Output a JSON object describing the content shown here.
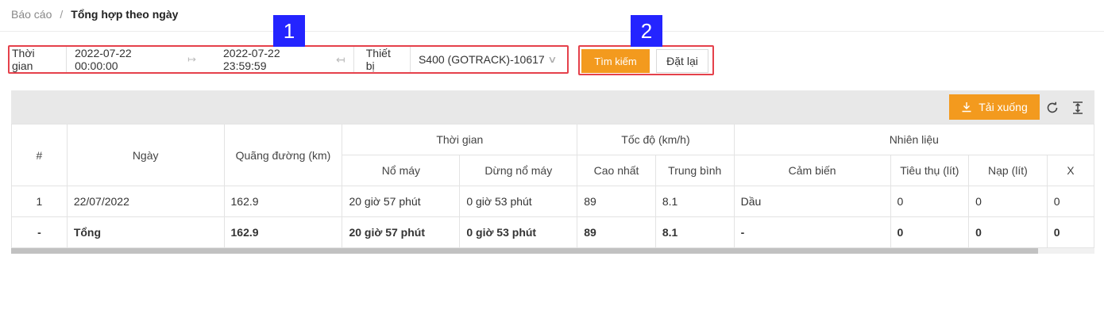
{
  "breadcrumb": {
    "root": "Báo cáo",
    "separator": "/",
    "current": "Tổng hợp theo ngày"
  },
  "filter": {
    "time_label": "Thời gian",
    "start": "2022-07-22 00:00:00",
    "end": "2022-07-22 23:59:59",
    "device_label": "Thiết bị",
    "device_value": "S400 (GOTRACK)-10617"
  },
  "actions": {
    "search_label": "Tìm kiếm",
    "reset_label": "Đặt lại",
    "download_label": "Tải xuống"
  },
  "badges": {
    "one": "1",
    "two": "2"
  },
  "table": {
    "headers": {
      "index": "#",
      "date": "Ngày",
      "distance": "Quãng đường (km)",
      "time_group": "Thời gian",
      "engine_on": "Nổ máy",
      "engine_idle": "Dừng nổ máy",
      "speed_group": "Tốc độ (km/h)",
      "speed_max": "Cao nhất",
      "speed_avg": "Trung bình",
      "fuel_group": "Nhiên liệu",
      "fuel_sensor": "Cảm biến",
      "fuel_consumed": "Tiêu thụ (lít)",
      "fuel_refill": "Nạp (lít)",
      "fuel_extra": "X"
    },
    "rows": [
      {
        "index": "1",
        "date": "22/07/2022",
        "distance": "162.9",
        "engine_on": "20 giờ 57 phút",
        "engine_idle": "0 giờ 53 phút",
        "speed_max": "89",
        "speed_avg": "8.1",
        "fuel_sensor": "Dầu",
        "fuel_consumed": "0",
        "fuel_refill": "0",
        "fuel_extra": "0"
      }
    ],
    "total": {
      "index": "-",
      "date": "Tổng",
      "distance": "162.9",
      "engine_on": "20 giờ 57 phút",
      "engine_idle": "0 giờ 53 phút",
      "speed_max": "89",
      "speed_avg": "8.1",
      "fuel_sensor": "-",
      "fuel_consumed": "0",
      "fuel_refill": "0",
      "fuel_extra": "0"
    }
  },
  "colors": {
    "accent": "#f39a1e",
    "highlight_border": "#e5414b",
    "badge": "#2424ff"
  }
}
